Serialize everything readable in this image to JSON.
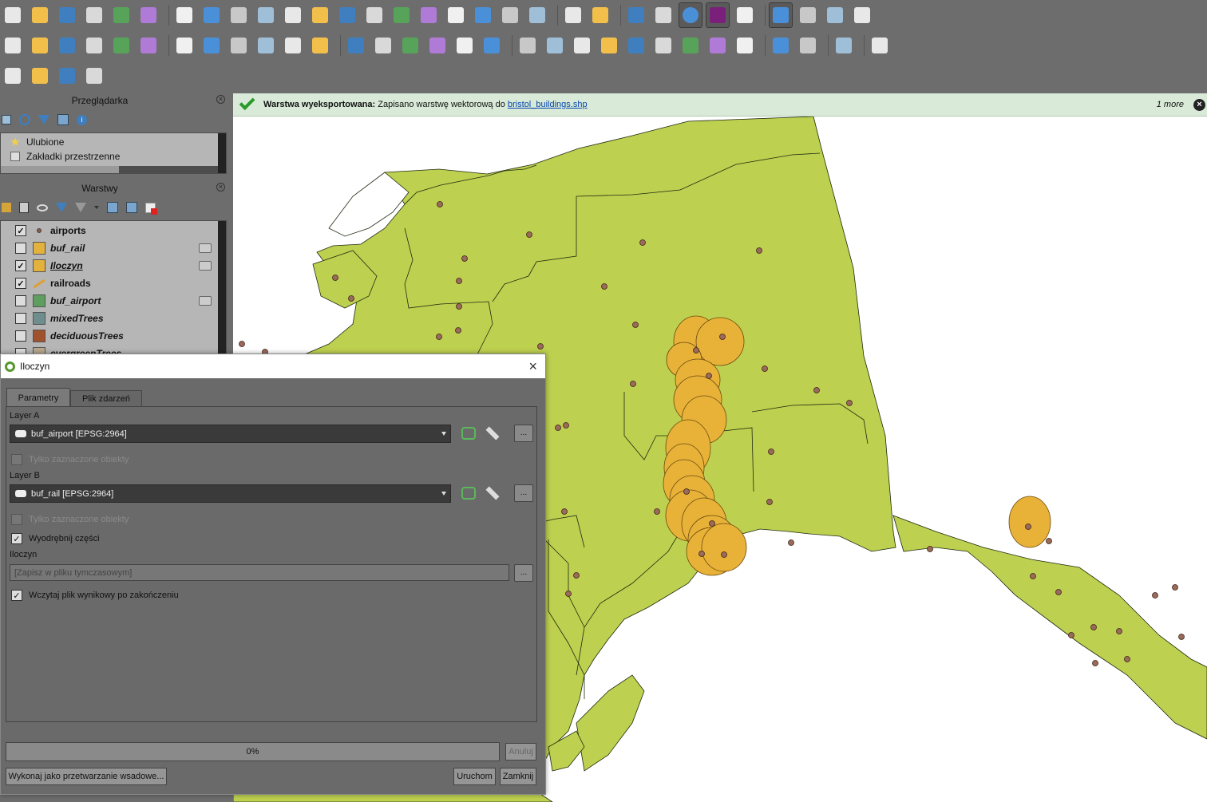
{
  "toolbar_icons": {
    "row1": [
      "new-project-icon",
      "open-project-icon",
      "save-project-icon",
      "save-as-icon",
      "print-layout-icon",
      "style-manager-icon",
      "pan-icon",
      "pan-to-selection-icon",
      "zoom-in-icon",
      "zoom-out-icon",
      "zoom-full-icon",
      "zoom-to-selection-icon",
      "zoom-to-layer-icon",
      "zoom-native-icon",
      "zoom-last-icon",
      "zoom-next-icon",
      "new-map-view-icon",
      "new-3d-view-icon",
      "new-bookmark-icon",
      "show-bookmarks-icon",
      "temporal-controller-icon",
      "refresh-icon",
      "identify-icon",
      "attribute-table-icon",
      "processing-settings-icon",
      "statistics-icon",
      "open-table-icon",
      "measure-icon",
      "annotation-icon",
      "settings-cog-icon",
      "text-annotation-icon"
    ],
    "row2": [
      "data-source-manager-icon",
      "new-geopackage-icon",
      "new-shapefile-icon",
      "new-spatialite-icon",
      "new-virtual-layer-icon",
      "new-temp-layer-icon",
      "digitize-pencil-icon",
      "toggle-editing-icon",
      "save-edits-icon",
      "add-feature-icon",
      "vertex-tool-icon",
      "modify-attributes-icon",
      "delete-feature-icon",
      "cut-feature-icon",
      "copy-feature-icon",
      "paste-feature-icon",
      "undo-icon",
      "redo-icon",
      "label-abc-icon",
      "diagram-icon",
      "label-pin-icon",
      "label-highlight-icon",
      "label-move-icon",
      "label-rotate-icon",
      "label-change-icon",
      "label-show-icon",
      "label-props-icon",
      "georeferencer-icon",
      "python-icon",
      "map-tile-icon",
      "help-icon"
    ],
    "row3": [
      "select-feature-icon",
      "select-by-expression-icon",
      "deselect-icon",
      "select-all-icon"
    ]
  },
  "browser_panel": {
    "title": "Przeglądarka",
    "items": [
      {
        "label": "Ulubione",
        "icon": "star-icon"
      },
      {
        "label": "Zakładki przestrzenne",
        "icon": "bookmark-icon"
      }
    ]
  },
  "layers_panel": {
    "title": "Warstwy",
    "layers": [
      {
        "name": "airports",
        "checked": true,
        "color": "#8b5a4a",
        "symbol": "point",
        "style": "bold"
      },
      {
        "name": "buf_rail",
        "checked": false,
        "color": "#e3b23c",
        "symbol": "fill",
        "style": "bold-italic",
        "indicator": true
      },
      {
        "name": "Iloczyn",
        "checked": true,
        "color": "#e3b23c",
        "symbol": "fill",
        "style": "bold-italic-underline",
        "indicator": true
      },
      {
        "name": "railroads",
        "checked": true,
        "color": "#e0a030",
        "symbol": "line",
        "style": "bold"
      },
      {
        "name": "buf_airport",
        "checked": false,
        "color": "#5e9e5e",
        "symbol": "fill",
        "style": "bold-italic",
        "indicator": true
      },
      {
        "name": "mixedTrees",
        "checked": false,
        "color": "#6e8e8e",
        "symbol": "fill",
        "style": "bold-italic"
      },
      {
        "name": "deciduousTrees",
        "checked": false,
        "color": "#a0522d",
        "symbol": "fill",
        "style": "bold-italic"
      },
      {
        "name": "evergreenTrees",
        "checked": false,
        "color": "#b8a88c",
        "symbol": "fill",
        "style": "bold-italic"
      }
    ]
  },
  "message_bar": {
    "title": "Warstwa wyeksportowana:",
    "text": "Zapisano warstwę wektorową do",
    "link": "bristol_buildings.shp",
    "more": "1 more",
    "color": "#d9ebd8"
  },
  "map": {
    "land_color": "#bed04f",
    "buffer_color": "#e8b238",
    "point_color": "#9b6a5a"
  },
  "dialog": {
    "title": "Iloczyn",
    "tabs": [
      "Parametry",
      "Plik zdarzeń"
    ],
    "layer_a_label": "Layer A",
    "layer_a_value": "buf_airport [EPSG:2964]",
    "layer_a_selected_only": "Tylko zaznaczone obiekty",
    "layer_b_label": "Layer B",
    "layer_b_value": "buf_rail [EPSG:2964]",
    "layer_b_selected_only": "Tylko zaznaczone obiekty",
    "extract_parts": "Wyodrębnij części",
    "output_label": "Iloczyn",
    "output_placeholder": "[Zapisz w pliku tymczasowym]",
    "load_output": "Wczytaj plik wynikowy po zakończeniu",
    "browse_label": "...",
    "progress": "0%",
    "cancel": "Anuluj",
    "batch": "Wykonaj jako przetwarzanie wsadowe...",
    "run": "Uruchom",
    "close": "Zamknij"
  }
}
